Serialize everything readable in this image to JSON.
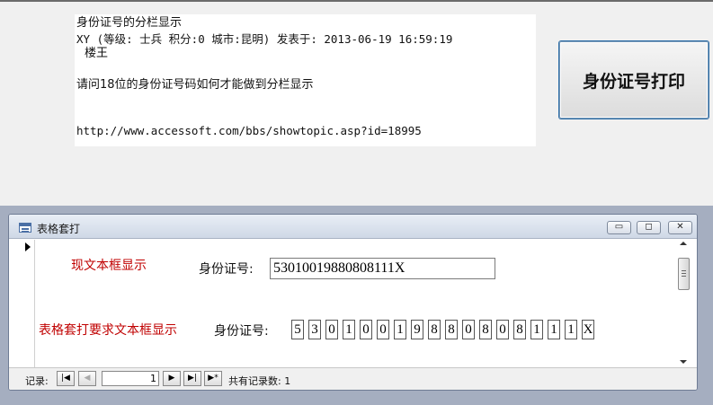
{
  "post": {
    "title": "身份证号的分栏显示",
    "meta": "XY  (等级: 士兵 积分:0  城市:昆明) 发表于: 2013-06-19 16:59:19",
    "floor": "楼王",
    "question": "请问18位的身份证号码如何才能做到分栏显示",
    "url": "http://www.accessoft.com/bbs/showtopic.asp?id=18995"
  },
  "print_button": {
    "label": "身份证号打印"
  },
  "form_window": {
    "title": "表格套打",
    "buttons": [
      "▭",
      "◻",
      "✕"
    ]
  },
  "form": {
    "current_textbox_label": "现文本框显示",
    "id_label_1": "身份证号:",
    "id_value": "53010019880808111X",
    "split_textbox_label": "表格套打要求文本框显示",
    "id_label_2": "身份证号:",
    "digits": [
      "5",
      "3",
      "0",
      "1",
      "0",
      "0",
      "1",
      "9",
      "8",
      "8",
      "0",
      "8",
      "0",
      "8",
      "1",
      "1",
      "1",
      "X"
    ]
  },
  "colors": {
    "accent_red": "#c00000"
  },
  "navigation": {
    "record_label": "记录:",
    "first_icon": "|◀",
    "prev_icon": "◀",
    "current_record": "1",
    "next_icon": "▶",
    "last_icon": "▶|",
    "new_icon": "▶*",
    "total_text": "共有记录数: 1"
  }
}
